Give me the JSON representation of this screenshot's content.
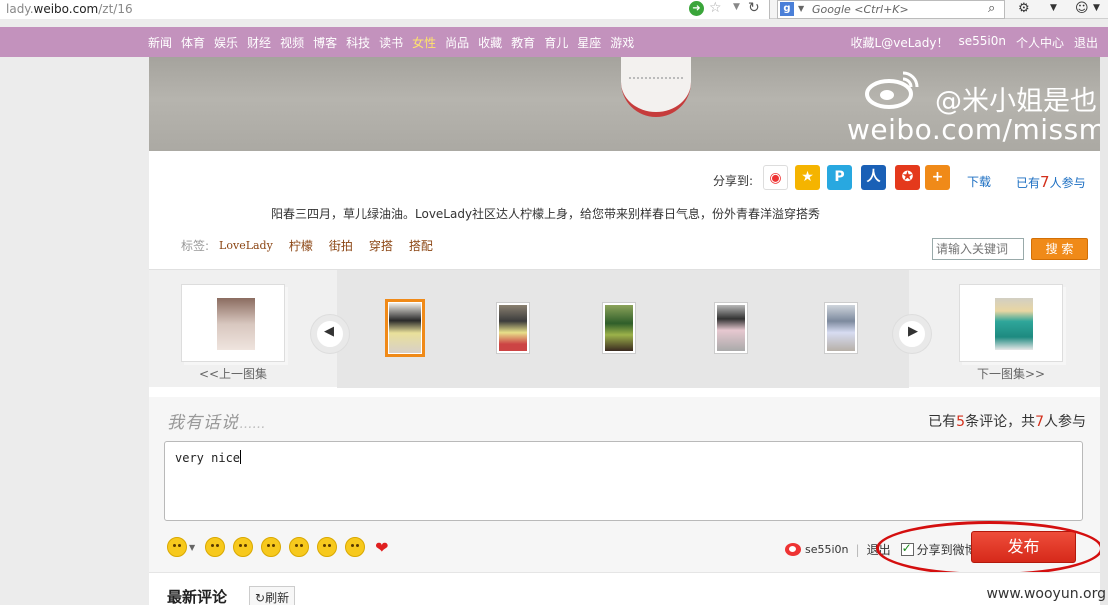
{
  "browser": {
    "url_prefix": "lady.",
    "url_domain": "weibo.com",
    "url_path": "/zt/16",
    "search_engine_placeholder": "Google <Ctrl+K>"
  },
  "topnav": {
    "items": [
      "新闻",
      "体育",
      "娱乐",
      "财经",
      "视频",
      "博客",
      "科技",
      "读书",
      "女性",
      "尚品",
      "收藏",
      "教育",
      "育儿",
      "星座",
      "游戏"
    ],
    "active_index": 8,
    "right": [
      "收藏L@veLady！",
      "se55i0n",
      "个人中心",
      "退出"
    ]
  },
  "banner": {
    "watermark_name": "@米小姐是也",
    "watermark_url": "weibo.com/missmis"
  },
  "share": {
    "label": "分享到:",
    "icons": [
      {
        "name": "sina-weibo-icon",
        "color": "#ffffff",
        "glyph": "◉"
      },
      {
        "name": "qzone-icon",
        "color": "#f5b400",
        "glyph": "★"
      },
      {
        "name": "tencent-weibo-icon",
        "color": "#28a8e0",
        "glyph": "P"
      },
      {
        "name": "renren-icon",
        "color": "#1a60b6",
        "glyph": "人"
      },
      {
        "name": "kaixin-icon",
        "color": "#e4391c",
        "glyph": "✪"
      },
      {
        "name": "more-share-icon",
        "color": "#f08a18",
        "glyph": "+"
      }
    ],
    "download": "下载",
    "joined_prefix": "已有",
    "joined_count": "7",
    "joined_suffix": "人参与"
  },
  "description": "阳春三四月，草儿绿油油。LoveLady社区达人柠檬上身，给您带来别样春日气息，份外青春洋溢穿搭秀",
  "tags": {
    "label": "标签:",
    "items": [
      "LoveLady",
      "柠檬",
      "街拍",
      "穿搭",
      "搭配"
    ]
  },
  "search": {
    "placeholder": "请输入关键词",
    "button": "搜 索"
  },
  "gallery": {
    "prev_label": "<<上一图集",
    "next_label": "下一图集>>",
    "selected_index": 0,
    "thumb_count": 6
  },
  "comment": {
    "title": "我有话说",
    "title_dots": "……",
    "count_prefix": "已有",
    "comment_count": "5",
    "count_mid": "条评论，共",
    "people_count": "7",
    "count_suffix": "人参与",
    "text": "very nice",
    "user": "se55i0n",
    "logout": "退出",
    "share_to_weibo": "分享到微博",
    "publish": "发布"
  },
  "latest": {
    "title": "最新评论",
    "refresh": "刷新"
  },
  "watermark_site": "www.wooyun.org"
}
